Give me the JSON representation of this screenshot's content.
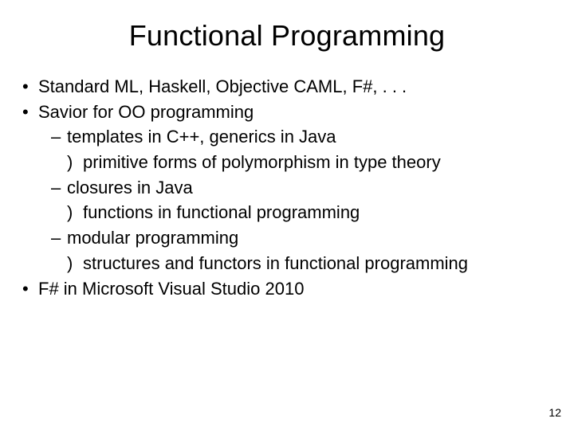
{
  "title": "Functional Programming",
  "bullets": {
    "b1": "Standard ML, Haskell, Objective CAML, F#, . . .",
    "b2": "Savior for OO programming",
    "b2a": "templates in C++, generics in Java",
    "b2a1": "primitive forms of polymorphism in type theory",
    "b2b": "closures in Java",
    "b2b1": "functions in functional programming",
    "b2c": "modular programming",
    "b2c1": "structures and functors in functional programming",
    "b3": "F# in Microsoft Visual Studio 2010"
  },
  "page_number": "12"
}
